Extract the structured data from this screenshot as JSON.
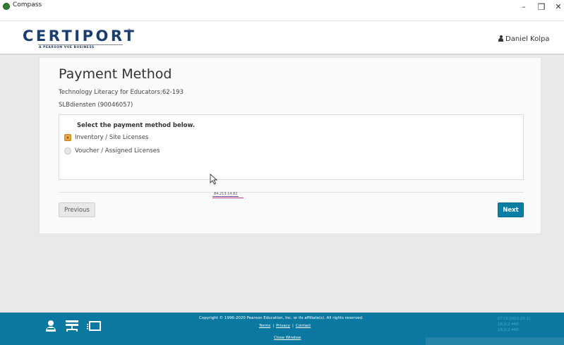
{
  "window": {
    "title": "Compass",
    "minimize": "–",
    "maximize": "❐",
    "close": "✕"
  },
  "header": {
    "logo_text": "CERTIPORT",
    "logo_tagline": "A PEARSON VUE BUSINESS",
    "user_name": "Daniel Kolpa",
    "brand_color": "#1a3e6e"
  },
  "main": {
    "title": "Payment Method",
    "exam": "Technology Literacy for Educators:62-193",
    "site": "SLBdiensten (90046057)",
    "panel": {
      "heading": "Select the payment method below.",
      "options": [
        {
          "label": "Inventory / Site Licenses",
          "selected": true
        },
        {
          "label": "Voucher / Assigned Licenses",
          "selected": false
        }
      ]
    },
    "ip_address": "84.213.14.82",
    "previous_label": "Previous",
    "next_label": "Next",
    "accent_color": "#0a7ea3",
    "selected_color": "#e8a33a"
  },
  "footer": {
    "copyright": "Copyright © 1996-2020 Pearson Education, Inc. or its affiliate(s). All rights reserved.",
    "links": [
      "Terms",
      "Privacy",
      "Contact"
    ],
    "link_separator": "|",
    "close_window": "Close Window",
    "versions": [
      "07 (3.2003.20.1)",
      "18.0.2.460",
      "19.0.2.460"
    ],
    "icons": [
      "proctor-icon",
      "network-icon",
      "monitor-icon"
    ],
    "background_color": "#0a78a1"
  }
}
